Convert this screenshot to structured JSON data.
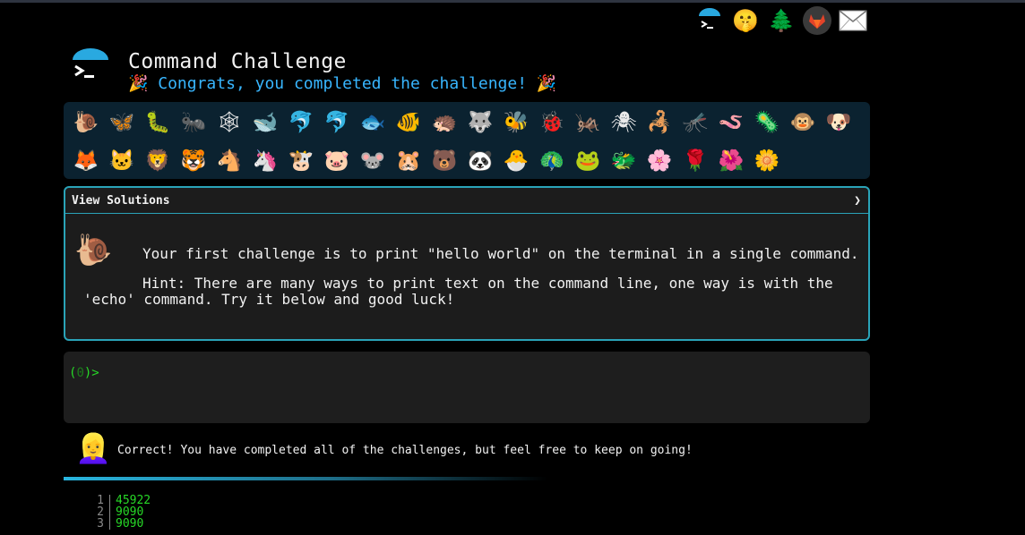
{
  "header": {
    "icons": [
      {
        "name": "terminal-logo-icon",
        "glyph": ""
      },
      {
        "name": "shushing-face-icon",
        "glyph": "🤫"
      },
      {
        "name": "evergreen-tree-icon",
        "glyph": "🌲"
      },
      {
        "name": "gitlab-icon",
        "glyph": "🦊"
      },
      {
        "name": "mail-icon",
        "glyph": "✉"
      }
    ]
  },
  "page": {
    "title": "Command Challenge",
    "subtitle": "🎉 Congrats, you completed the challenge! 🎉"
  },
  "animals": {
    "row1": [
      "🐌",
      "🦋",
      "🐛",
      "🐜",
      "🕸",
      "🐋",
      "🐬",
      "🐬",
      "🐟",
      "🐠",
      "🦔",
      "🐺",
      "🐝",
      "🐞",
      "🦗",
      "🕷",
      "🦂",
      "🦟",
      "🪱",
      "🦠",
      "🐵",
      "🐶"
    ],
    "row2": [
      "🦊",
      "🐱",
      "🦁",
      "🐯",
      "🐴",
      "🦄",
      "🐮",
      "🐷",
      "🐭",
      "🐹",
      "🐻",
      "🐼",
      "🐣",
      "🦚",
      "🐸",
      "🐲",
      "🌸",
      "🌹",
      "🌺",
      "🌼"
    ]
  },
  "challenge": {
    "view_solutions": "View Solutions",
    "expand_glyph": "❯",
    "icon": "🐌",
    "text": "Your first challenge is to print \"hello world\" on the terminal in a single command.",
    "hint_line1": "Hint: There are many ways to print text on the command line, one way is with the",
    "hint_line2": "'echo' command. Try it below and good luck!"
  },
  "terminal": {
    "prompt_open": "(",
    "prompt_code": "0",
    "prompt_close": ")>"
  },
  "result": {
    "avatar": "👱‍♀️",
    "message": "Correct! You have completed all of the challenges, but feel free to keep on going!"
  },
  "output": {
    "lines": [
      {
        "n": "1",
        "v": "45922"
      },
      {
        "n": "2",
        "v": "9090"
      },
      {
        "n": "3",
        "v": "9090"
      }
    ]
  },
  "colors": {
    "accent": "#38b6ff",
    "border": "#2aa3b8",
    "success": "#27d927"
  }
}
